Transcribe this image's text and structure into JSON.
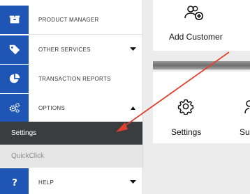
{
  "sidebar": {
    "items": [
      {
        "label": "PRODUCT MANAGER",
        "icon": "box-icon"
      },
      {
        "label": "OTHER SERVICES",
        "icon": "tag-icon",
        "caret": "down"
      },
      {
        "label": "TRANSACTION REPORTS",
        "icon": "pie-chart-icon"
      },
      {
        "label": "OPTIONS",
        "icon": "gears-icon",
        "caret": "up"
      },
      {
        "label": "HELP",
        "icon": "question-icon",
        "caret": "down"
      }
    ],
    "options_submenu": [
      {
        "label": "Settings",
        "active": true
      },
      {
        "label": "QuickClick",
        "active": false
      }
    ]
  },
  "main": {
    "cards": [
      {
        "label": "Add Customer",
        "icon": "add-user-icon"
      },
      {
        "label": "Settings",
        "icon": "gear-icon"
      },
      {
        "label": "Su",
        "icon": "user-icon"
      }
    ]
  },
  "colors": {
    "nav_icon_bg": "#1f56b6",
    "active_submenu_bg": "#3a3d3f",
    "annotation_arrow": "#e0412f"
  }
}
